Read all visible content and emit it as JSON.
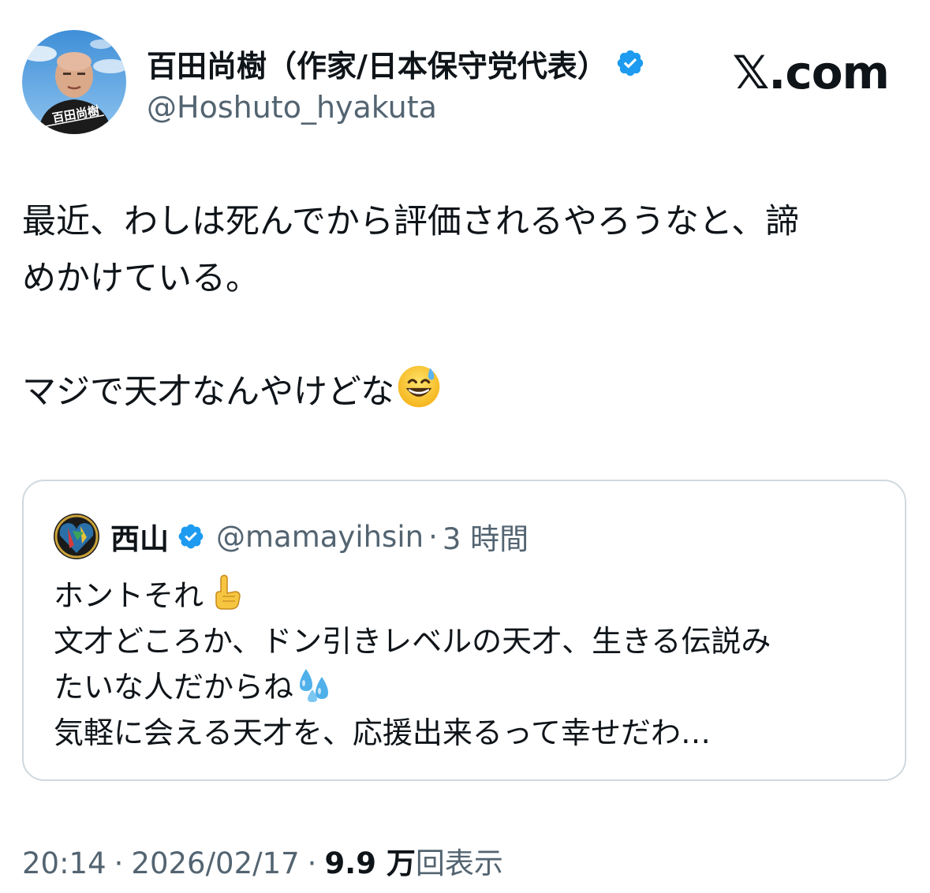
{
  "author": {
    "name": "百田尚樹（作家/日本保守党代表）",
    "handle": "@Hoshuto_hyakuta",
    "avatar_caption": "百田尚樹",
    "verified": true
  },
  "brand": {
    "logo_text": "𝕏.com"
  },
  "tweet": {
    "lines": [
      "最近、わしは死んでから評価されるやろうなと、諦",
      "めかけている。",
      "",
      "マジで天才なんやけどな"
    ],
    "emoji": "grinning-face-with-sweat"
  },
  "quote": {
    "author": "西山",
    "handle": "@mamayihsin",
    "separator": "·",
    "time": "3 時間",
    "lines": [
      "ホントそれ",
      "文才どころか、ドン引きレベルの天才、生きる伝説み",
      "たいな人だからね",
      "気軽に会える天才を、応援出来るって幸せだわ…"
    ],
    "emojis": [
      "pointing-up-finger",
      "sweat-droplets"
    ]
  },
  "footer": {
    "time": "20:14",
    "separator": "·",
    "date": "2026/02/17",
    "views_count": "9.9 万",
    "views_label": "回表示"
  },
  "colors": {
    "text_primary": "#0f1419",
    "text_secondary": "#536471",
    "verified_blue": "#1d9bf0",
    "card_border": "#cfd9de"
  }
}
